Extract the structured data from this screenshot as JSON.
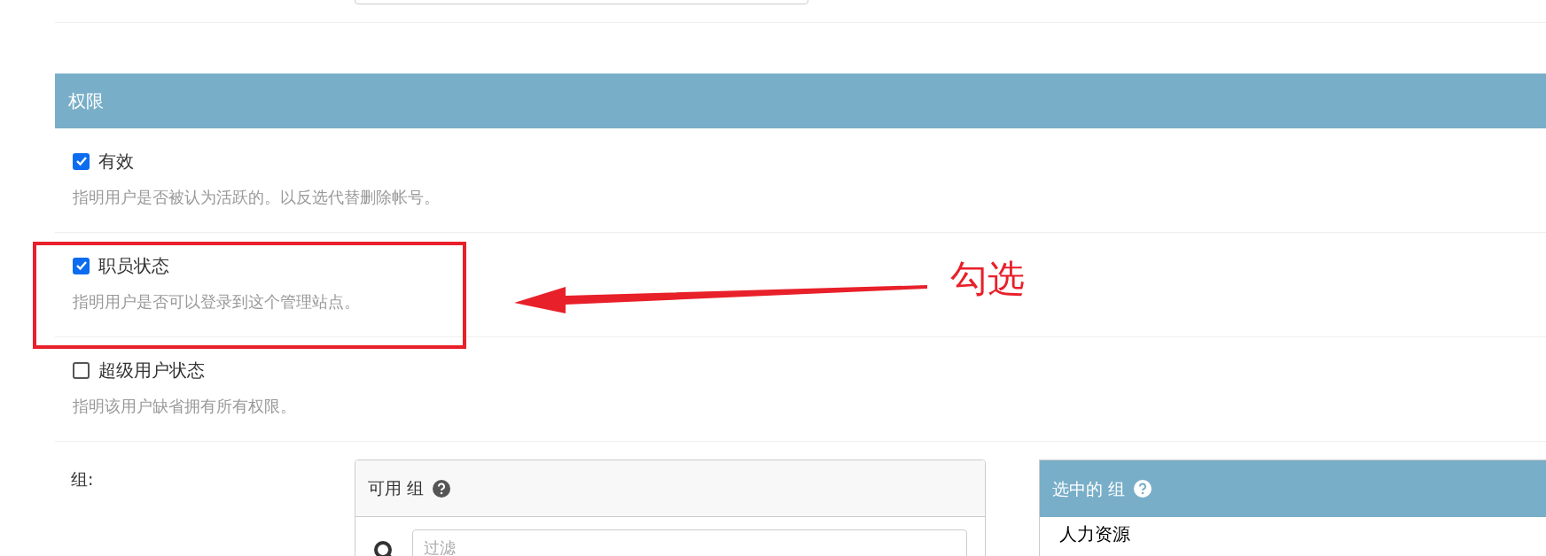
{
  "section": {
    "title": "权限"
  },
  "fields": [
    {
      "label": "有效",
      "checked": true,
      "help": "指明用户是否被认为活跃的。以反选代替删除帐号。",
      "highlighted": false
    },
    {
      "label": "职员状态",
      "checked": true,
      "help": "指明用户是否可以登录到这个管理站点。",
      "highlighted": true
    },
    {
      "label": "超级用户状态",
      "checked": false,
      "help": "指明该用户缺省拥有所有权限。",
      "highlighted": false
    }
  ],
  "annotation": {
    "text": "勾选"
  },
  "groups": {
    "label": "组:",
    "available": {
      "title": "可用 组",
      "filter_placeholder": "过滤"
    },
    "chosen": {
      "title": "选中的 组",
      "items": [
        "人力资源"
      ]
    }
  }
}
